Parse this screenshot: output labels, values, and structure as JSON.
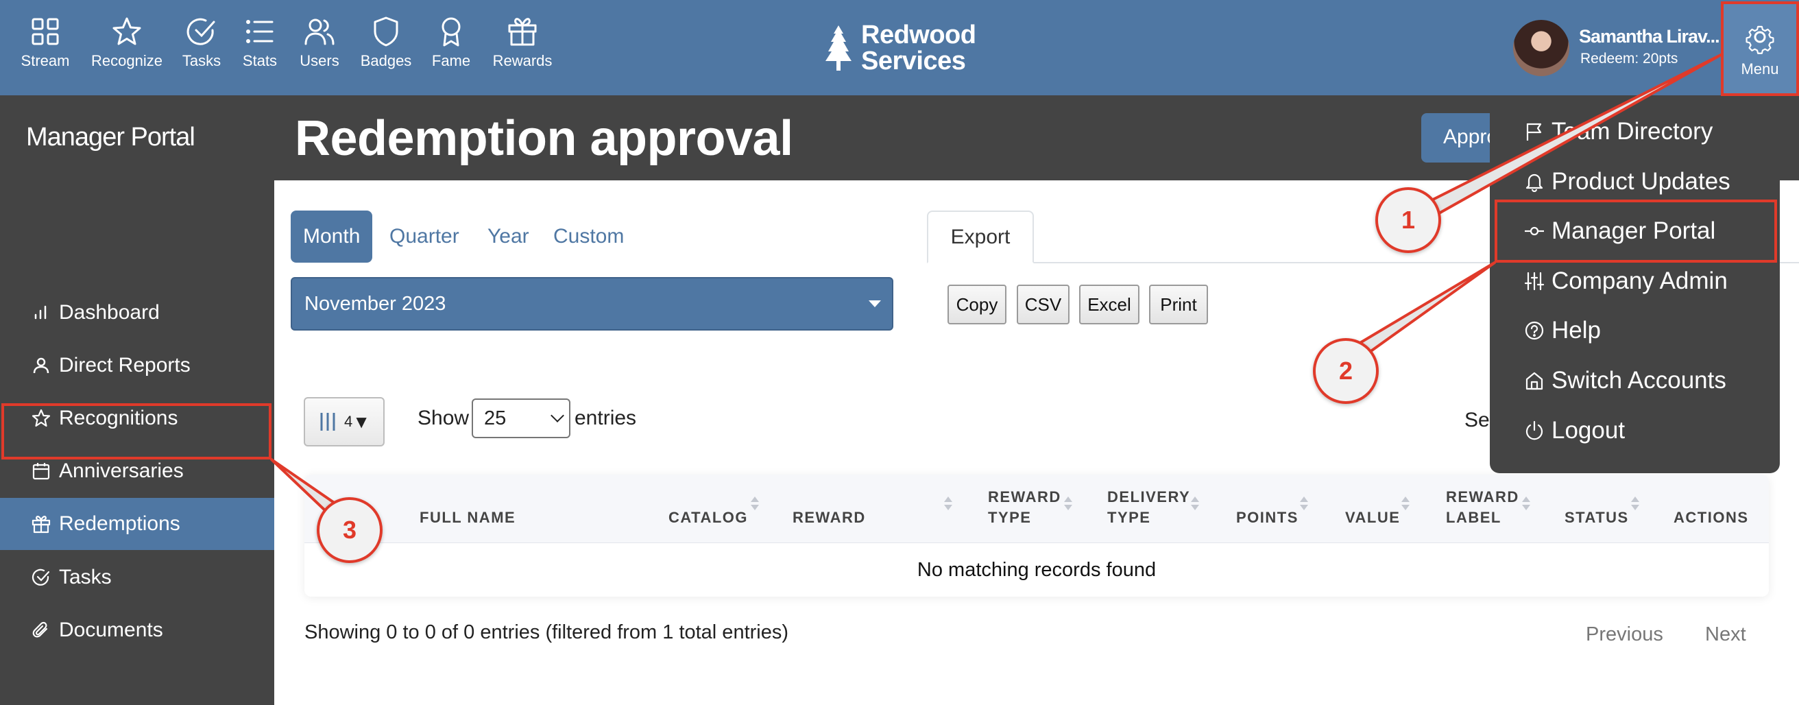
{
  "topnav": {
    "items": [
      {
        "label": "Stream",
        "icon": "grid-icon"
      },
      {
        "label": "Recognize",
        "icon": "star-icon"
      },
      {
        "label": "Tasks",
        "icon": "check-circle-icon"
      },
      {
        "label": "Stats",
        "icon": "list-icon"
      },
      {
        "label": "Users",
        "icon": "users-icon"
      },
      {
        "label": "Badges",
        "icon": "shield-icon"
      },
      {
        "label": "Fame",
        "icon": "award-icon"
      },
      {
        "label": "Rewards",
        "icon": "gift-icon"
      }
    ],
    "brand_line1": "Redwood",
    "brand_line2": "Services",
    "user_name": "Samantha Lirav...",
    "user_points": "Redeem: 20pts",
    "menu_label": "Menu"
  },
  "sidebar": {
    "title": "Manager Portal",
    "items": [
      {
        "label": "Dashboard",
        "icon": "bar-chart-icon"
      },
      {
        "label": "Direct Reports",
        "icon": "person-icon"
      },
      {
        "label": "Recognitions",
        "icon": "star-icon"
      },
      {
        "label": "Anniversaries",
        "icon": "calendar-icon"
      },
      {
        "label": "Redemptions",
        "icon": "gift-icon",
        "active": true
      },
      {
        "label": "Tasks",
        "icon": "check-circle-icon"
      },
      {
        "label": "Documents",
        "icon": "paperclip-icon"
      }
    ]
  },
  "header": {
    "title": "Redemption approval",
    "approve_button": "Appro"
  },
  "filters": {
    "tabs": [
      "Month",
      "Quarter",
      "Year",
      "Custom"
    ],
    "selected_period": "November 2023"
  },
  "export": {
    "tab_label": "Export",
    "buttons": [
      "Copy",
      "CSV",
      "Excel",
      "Print"
    ]
  },
  "table_controls": {
    "column_count": "4",
    "show_label": "Show",
    "entries_value": "25",
    "entries_label": "entries",
    "search_label": "Sea"
  },
  "table": {
    "headers": [
      {
        "line1": "FULL NAME",
        "line2": ""
      },
      {
        "line1": "CATALOG",
        "line2": ""
      },
      {
        "line1": "REWARD",
        "line2": ""
      },
      {
        "line1": "REWARD",
        "line2": "TYPE"
      },
      {
        "line1": "DELIVERY",
        "line2": "TYPE"
      },
      {
        "line1": "POINTS",
        "line2": ""
      },
      {
        "line1": "VALUE",
        "line2": ""
      },
      {
        "line1": "REWARD",
        "line2": "LABEL"
      },
      {
        "line1": "STATUS",
        "line2": ""
      },
      {
        "line1": "ACTIONS",
        "line2": ""
      }
    ],
    "empty_message": "No matching records found"
  },
  "pagination": {
    "info": "Showing 0 to 0 of 0 entries (filtered from 1 total entries)",
    "previous": "Previous",
    "next": "Next"
  },
  "dropdown": {
    "items": [
      {
        "label": "Team Directory",
        "icon": "flag-icon"
      },
      {
        "label": "Product Updates",
        "icon": "bell-icon"
      },
      {
        "label": "Manager Portal",
        "icon": "commit-icon"
      },
      {
        "label": "Company Admin",
        "icon": "sliders-icon"
      },
      {
        "label": "Help",
        "icon": "question-circle-icon"
      },
      {
        "label": "Switch Accounts",
        "icon": "home-icon"
      },
      {
        "label": "Logout",
        "icon": "power-icon"
      }
    ]
  },
  "annotations": {
    "step1": "1",
    "step2": "2",
    "step3": "3",
    "color": "#e03a2a"
  }
}
